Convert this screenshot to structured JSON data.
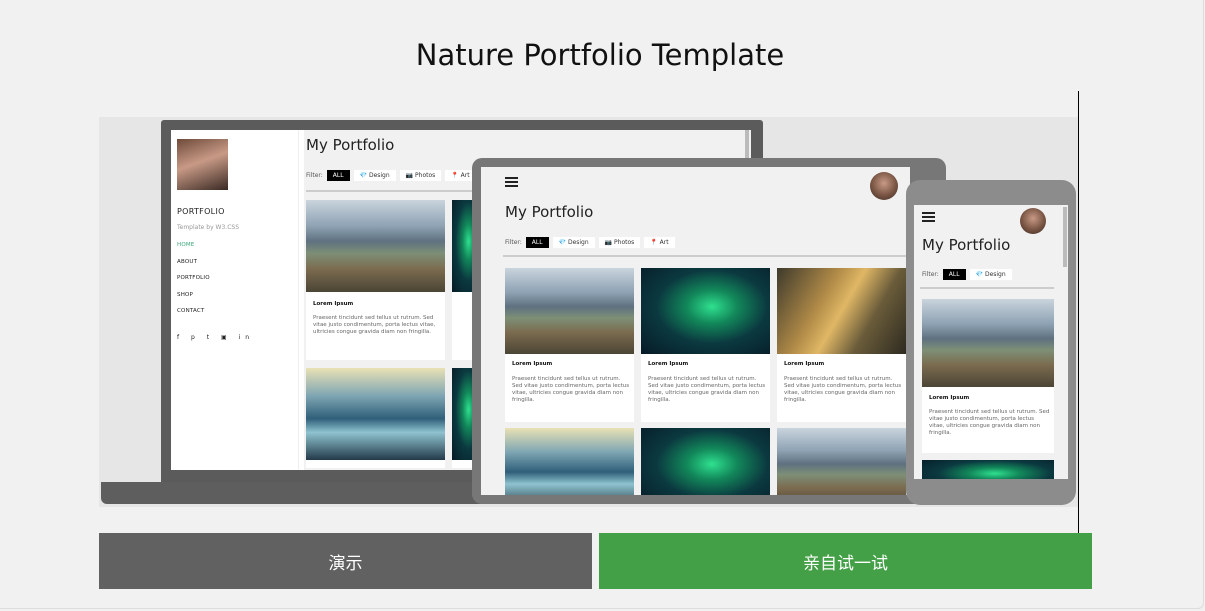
{
  "page": {
    "title": "Nature Portfolio Template"
  },
  "laptop": {
    "sidebar": {
      "brand": "PORTFOLIO",
      "subtitle": "Template by W3.CSS",
      "nav": [
        "HOME",
        "ABOUT",
        "PORTFOLIO",
        "SHOP",
        "CONTACT"
      ],
      "social": "f p t ▣ in"
    },
    "heading": "My Portfolio",
    "filter_label": "Filter:",
    "filters": [
      "ALL",
      "💎 Design",
      "📷 Photos",
      "📍 Art"
    ],
    "card_title": "Lorem Ipsum",
    "card_text": "Praesent tincidunt sed tellus ut rutrum. Sed vitae justo condimentum, porta lectus vitae, ultricies congue gravida diam non fringilla."
  },
  "tablet": {
    "heading": "My Portfolio",
    "filter_label": "Filter:",
    "filters": [
      "ALL",
      "💎 Design",
      "📷 Photos",
      "📍 Art"
    ],
    "card_title": "Lorem Ipsum",
    "card_text": "Praesent tincidunt sed tellus ut rutrum. Sed vitae justo condimentum, porta lectus vitae, ultricies congue gravida diam non fringilla."
  },
  "phone": {
    "heading": "My Portfolio",
    "filter_label": "Filter:",
    "filters": [
      "ALL",
      "💎 Design"
    ],
    "card_title": "Lorem Ipsum",
    "card_text": "Praesent tincidunt sed tellus ut rutrum. Sed vitae justo condimentum, porta lectus vitae, ultricies congue gravida diam non fringilla."
  },
  "buttons": {
    "demo": "演示",
    "try": "亲自试一试"
  },
  "colors": {
    "demo_bg": "#616161",
    "try_bg": "#43a047",
    "active_nav": "#3aa878"
  }
}
